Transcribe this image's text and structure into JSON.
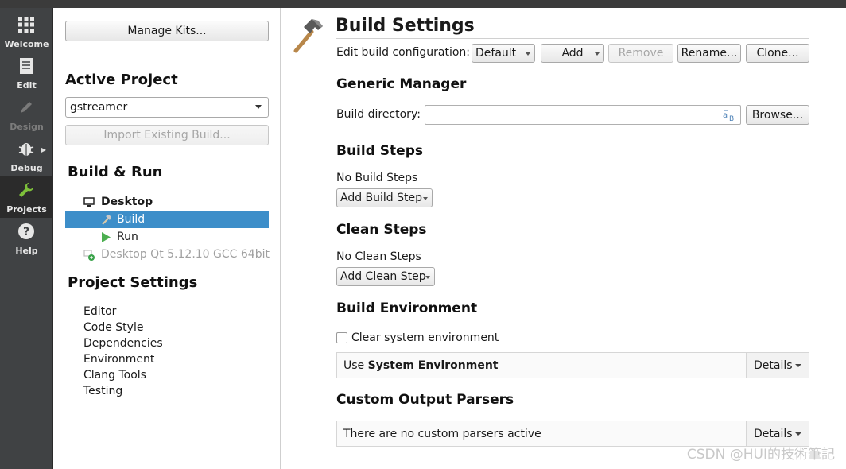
{
  "modebar": {
    "items": [
      {
        "label": "Welcome",
        "icon": "grid-icon"
      },
      {
        "label": "Edit",
        "icon": "document-icon"
      },
      {
        "label": "Design",
        "icon": "pencil-icon"
      },
      {
        "label": "Debug",
        "icon": "bug-icon"
      },
      {
        "label": "Projects",
        "icon": "wrench-icon"
      },
      {
        "label": "Help",
        "icon": "help-icon"
      }
    ],
    "active": "Projects"
  },
  "left": {
    "manage_kits": "Manage Kits...",
    "active_project_heading": "Active Project",
    "project_selected": "gstreamer",
    "import_build": "Import Existing Build...",
    "build_run_heading": "Build & Run",
    "tree": {
      "kit": "Desktop",
      "build": "Build",
      "run": "Run",
      "other_kit": "Desktop Qt 5.12.10 GCC 64bit"
    },
    "project_settings_heading": "Project Settings",
    "settings": [
      "Editor",
      "Code Style",
      "Dependencies",
      "Environment",
      "Clang Tools",
      "Testing"
    ]
  },
  "main": {
    "title": "Build Settings",
    "edit_config_label": "Edit build configuration:",
    "config_value": "Default",
    "add": "Add",
    "remove": "Remove",
    "rename": "Rename...",
    "clone": "Clone...",
    "generic_manager": "Generic Manager",
    "build_dir_label": "Build directory:",
    "build_dir_value": "",
    "browse": "Browse...",
    "build_steps": "Build Steps",
    "no_build_steps": "No Build Steps",
    "add_build_step": "Add Build Step",
    "clean_steps": "Clean Steps",
    "no_clean_steps": "No Clean Steps",
    "add_clean_step": "Add Clean Step",
    "build_env": "Build Environment",
    "clear_env": "Clear system environment",
    "use_prefix": "Use ",
    "use_bold": "System Environment",
    "details": "Details",
    "custom_parsers": "Custom Output Parsers",
    "no_parsers": "There are no custom parsers active"
  },
  "colors": {
    "selection": "#3d8ec9",
    "modebar_bg": "#404244",
    "run_green": "#4caf50"
  },
  "watermark": "CSDN @HUI的技術筆記"
}
